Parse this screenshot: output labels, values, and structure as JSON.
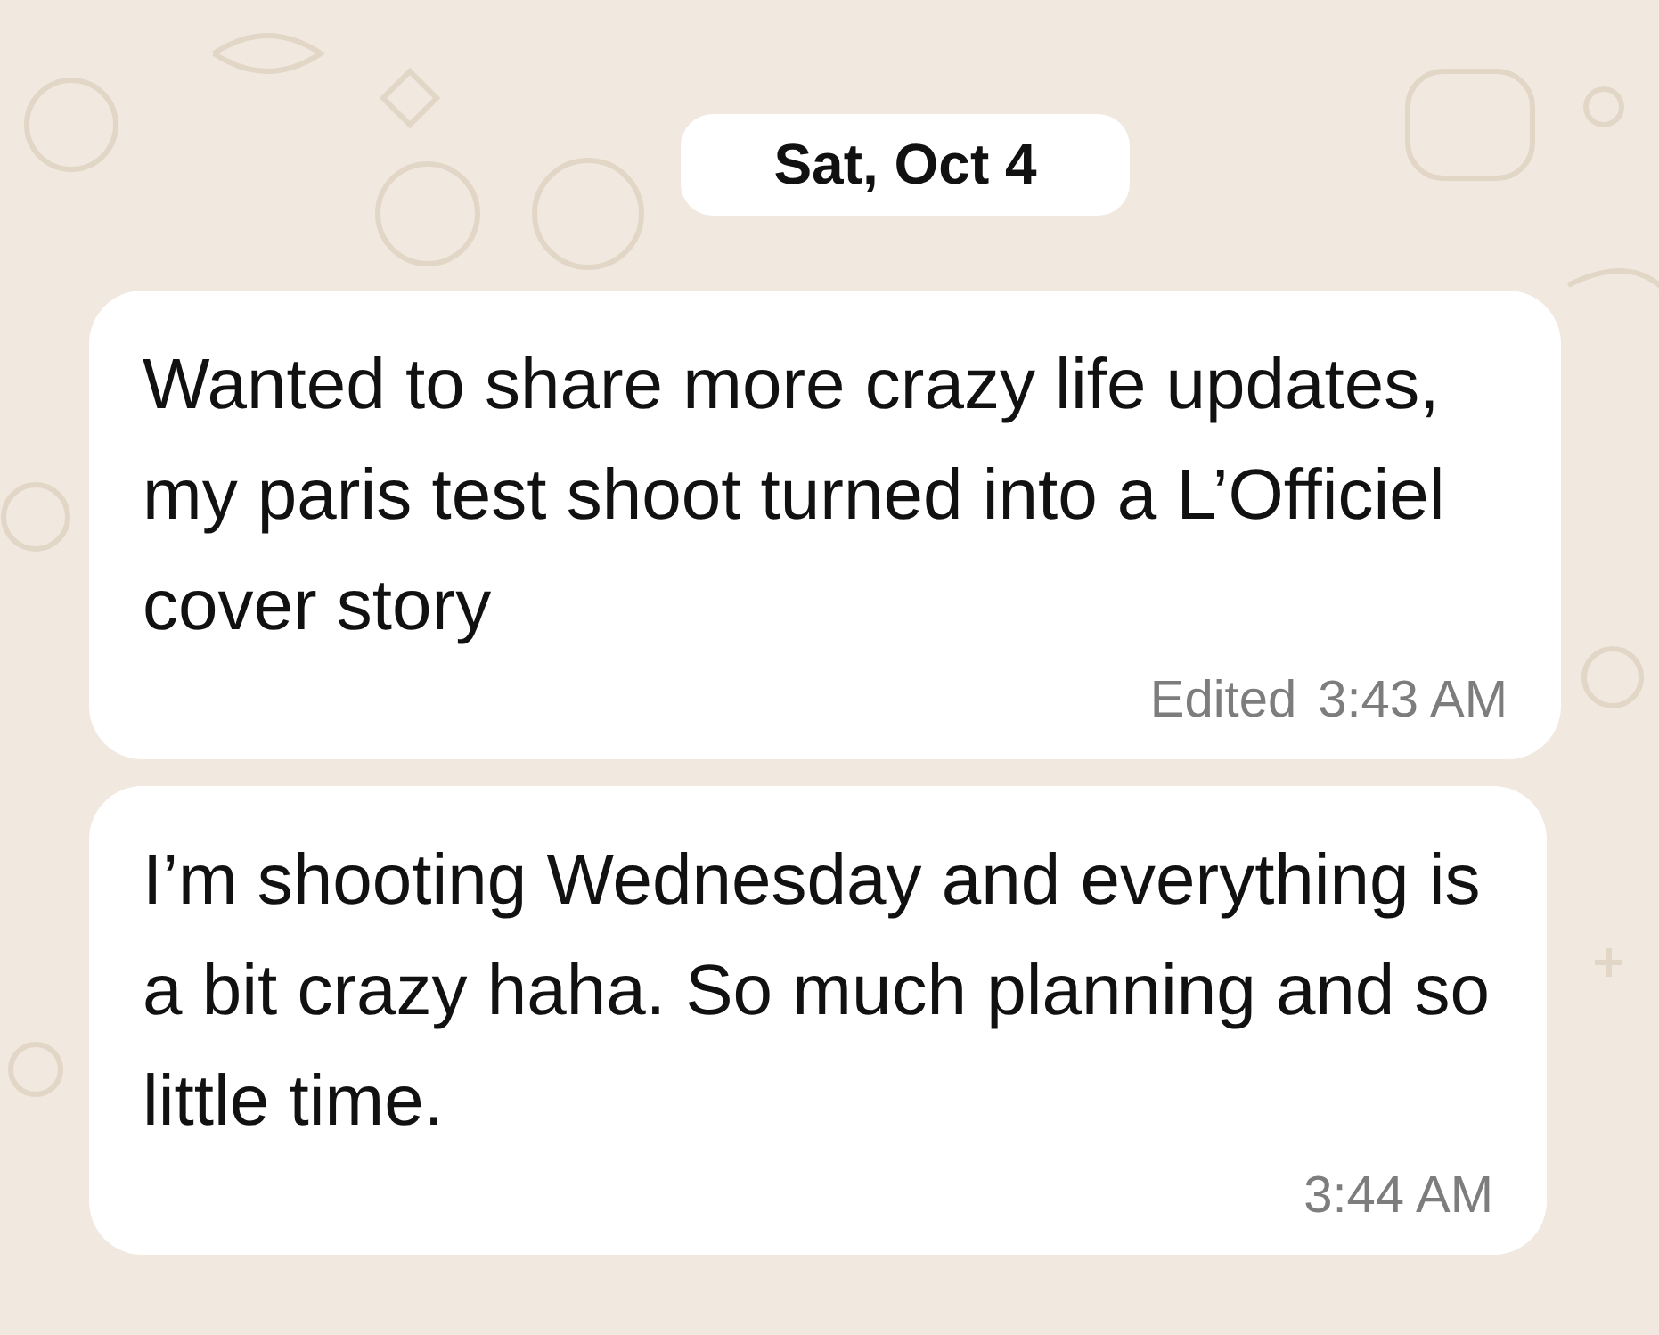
{
  "date_label": "Sat, Oct 4",
  "messages": [
    {
      "text": "Wanted to share more crazy life updates, my paris test shoot turned into a L’Officiel cover story",
      "edited_label": "Edited",
      "time": "3:43 AM"
    },
    {
      "text": "I’m shooting Wednesday and everything is a bit crazy haha. So much planning and so little time.",
      "time": "3:44 AM"
    }
  ]
}
